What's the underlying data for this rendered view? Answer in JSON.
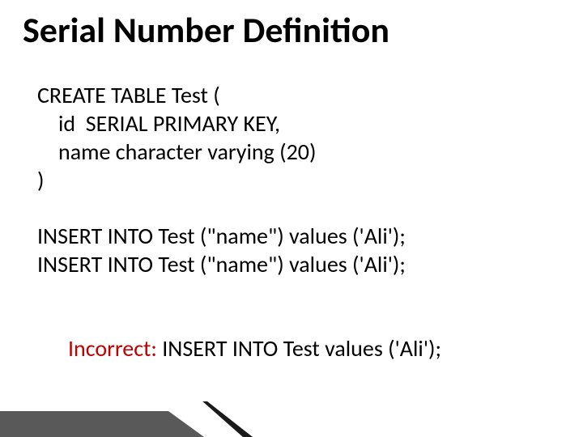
{
  "title": "Serial Number Definition",
  "code": {
    "line1": "CREATE TABLE Test (",
    "line2": "id  SERIAL PRIMARY KEY,",
    "line3": "name character varying (20)",
    "line4": ")"
  },
  "inserts": {
    "line1": "INSERT INTO Test (\"name\") values ('Ali');",
    "line2": "INSERT INTO Test (\"name\") values ('Ali');"
  },
  "incorrect": {
    "label": "Incorrect:",
    "rest": " INSERT INTO Test values ('Ali');"
  }
}
